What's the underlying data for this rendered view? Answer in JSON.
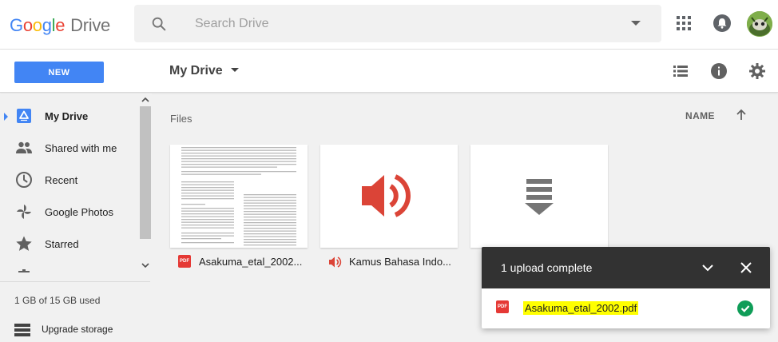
{
  "header": {
    "logo_google": [
      "G",
      "o",
      "o",
      "g",
      "l",
      "e"
    ],
    "logo_product": "Drive",
    "search_placeholder": "Search Drive"
  },
  "toolbar": {
    "new_label": "NEW",
    "drive_title": "My Drive"
  },
  "sidebar": {
    "items": [
      {
        "label": "My Drive",
        "icon": "my-drive-icon",
        "active": true
      },
      {
        "label": "Shared with me",
        "icon": "people-icon"
      },
      {
        "label": "Recent",
        "icon": "clock-icon"
      },
      {
        "label": "Google Photos",
        "icon": "photos-pinwheel-icon"
      },
      {
        "label": "Starred",
        "icon": "star-icon"
      }
    ],
    "storage_text": "1 GB of 15 GB used",
    "upgrade_label": "Upgrade storage"
  },
  "main": {
    "section_label": "Files",
    "sort_label": "NAME",
    "files": [
      {
        "name": "Asakuma_etal_2002...",
        "type": "pdf",
        "type_label": "PDF"
      },
      {
        "name": "Kamus Bahasa Indo...",
        "type": "audio"
      },
      {
        "name": "",
        "type": "download"
      }
    ]
  },
  "upload": {
    "title": "1 upload complete",
    "file_name": "Asakuma_etal_2002.pdf",
    "file_type_label": "PDF",
    "status": "complete"
  },
  "colors": {
    "accent": "#4285f4",
    "pdf_red": "#e53935",
    "audio_red": "#db4437",
    "success_green": "#0f9d58",
    "panel_dark": "#323232",
    "highlight": "#ffff00"
  }
}
